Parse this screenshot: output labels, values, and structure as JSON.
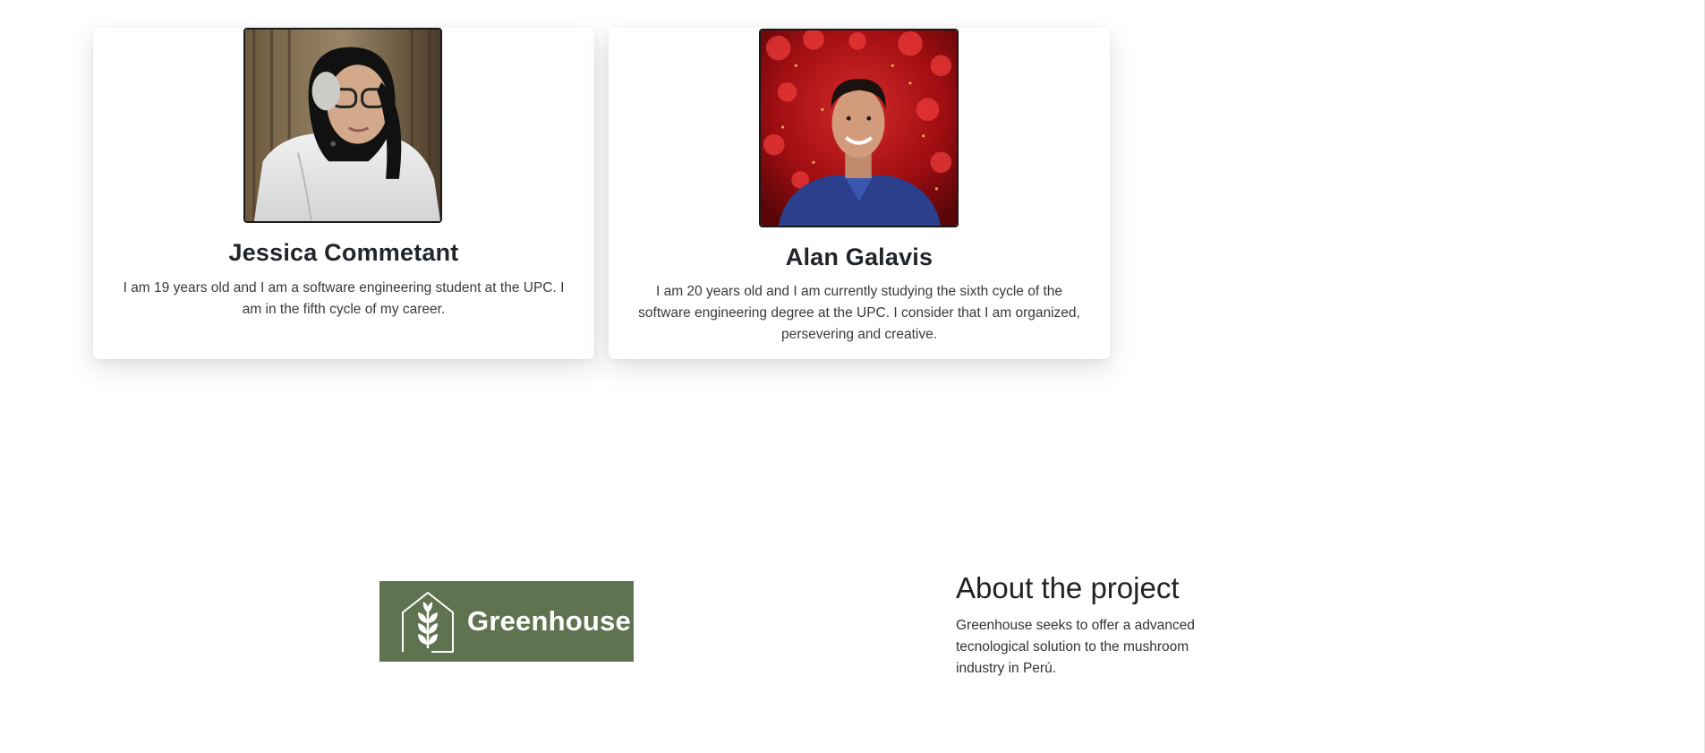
{
  "team": [
    {
      "name": "Jessica Commetant",
      "bio": "I am 19 years old and I am a software engineering student at the UPC. I am in the fifth cycle of my career."
    },
    {
      "name": "Alan Galavis",
      "bio": "I am 20 years old and I am currently studying the sixth cycle of the software engineering degree at the UPC. I consider that I am organized, persevering and creative."
    }
  ],
  "about": {
    "logo_text": "Greenhouse",
    "logo_icon": "greenhouse-wheat-icon",
    "title": "About the project",
    "text": "Greenhouse seeks to offer a advanced tecnological solution to the mushroom industry in Perú."
  },
  "colors": {
    "logo_bg": "#5f7351",
    "card_bg": "#ffffff",
    "photo_border": "#1a1a1a"
  }
}
